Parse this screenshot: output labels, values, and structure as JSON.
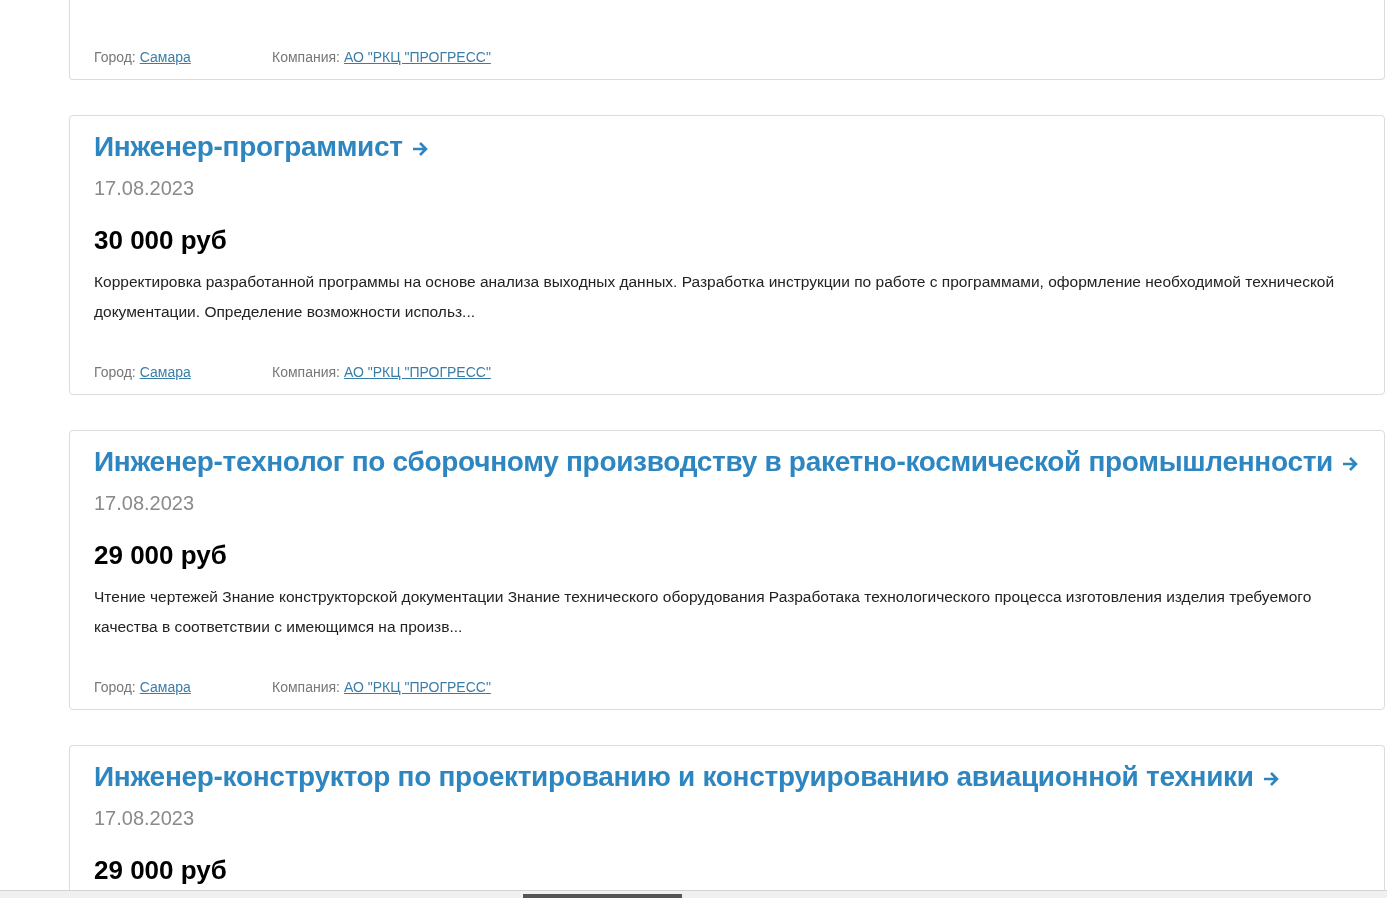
{
  "vacancies": [
    {
      "city_label": "Город:",
      "city": "Самара",
      "company_label": "Компания:",
      "company": "АО \"РКЦ \"ПРОГРЕСС\""
    },
    {
      "title": "Инженер-программист",
      "date": "17.08.2023",
      "salary": "30 000 руб",
      "description": "Корректировка разработанной программы на основе анализа выходных данных. Разработка инструкции по работе с программами, оформление необходимой технической документации. Определение возможности использ...",
      "city_label": "Город:",
      "city": "Самара",
      "company_label": "Компания:",
      "company": "АО \"РКЦ \"ПРОГРЕСС\""
    },
    {
      "title": "Инженер-технолог по сборочному производству в ракетно-космической промышленности",
      "date": "17.08.2023",
      "salary": "29 000 руб",
      "description": "Чтение чертежей Знание конструкторской документации Знание технического оборудования Разработака технологического процесса изготовления изделия требуемого качества в соответствии с имеющимся на произв...",
      "city_label": "Город:",
      "city": "Самара",
      "company_label": "Компания:",
      "company": "АО \"РКЦ \"ПРОГРЕСС\""
    },
    {
      "title": "Инженер-конструктор по проектированию и конструированию авиационной техники",
      "date": "17.08.2023",
      "salary": "29 000 руб"
    }
  ]
}
